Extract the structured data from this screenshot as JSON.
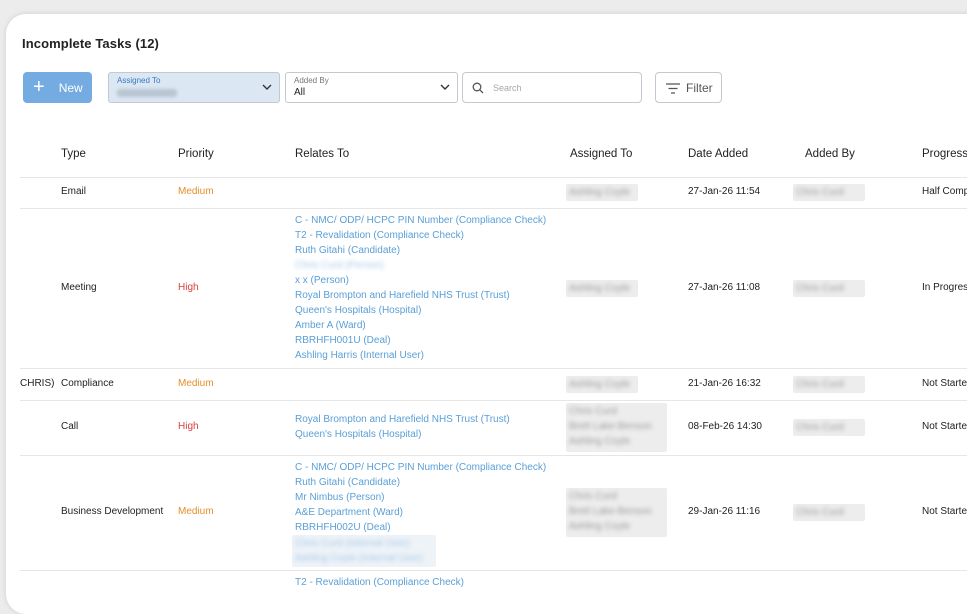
{
  "page": {
    "title": "Incomplete Tasks (12)"
  },
  "toolbar": {
    "new_label": "New",
    "assigned_to": {
      "label": "Assigned To",
      "value": "Ashling Coyle"
    },
    "added_by": {
      "label": "Added By",
      "value": "All"
    },
    "search_placeholder": "Search",
    "filter_label": "Filter"
  },
  "table": {
    "headers": [
      "Type",
      "Priority",
      "Relates To",
      "Assigned To",
      "Date Added",
      "Added By",
      "Progress"
    ],
    "rows": [
      {
        "type": "Email",
        "priority": "Medium",
        "relates_to": [],
        "assigned_to": [
          "Ashling Coyle"
        ],
        "date_added": "27-Jan-26 11:54",
        "added_by": "Chris Curd",
        "progress": "Half Comp"
      },
      {
        "type": "Meeting",
        "priority": "High",
        "relates_to": [
          "C - NMC/ ODP/ HCPC PIN Number (Compliance Check)",
          "T2 - Revalidation (Compliance Check)",
          "Ruth Gitahi (Candidate)",
          "Chris Curd (Person)",
          "x x (Person)",
          "Royal Brompton and Harefield NHS Trust (Trust)",
          "Queen's Hospitals (Hospital)",
          "Amber A (Ward)",
          "RBRHFH001U (Deal)",
          "Ashling Harris (Internal User)"
        ],
        "assigned_to": [
          "Ashling Coyle"
        ],
        "date_added": "27-Jan-26 11:08",
        "added_by": "Chris Curd",
        "progress": "In Progres"
      },
      {
        "type": "Compliance",
        "priority": "Medium",
        "row_prefix": "CHRIS)",
        "relates_to": [],
        "assigned_to": [
          "Ashling Coyle"
        ],
        "date_added": "21-Jan-26 16:32",
        "added_by": "Chris Curd",
        "progress": "Not Starte"
      },
      {
        "type": "Call",
        "priority": "High",
        "relates_to": [
          "Royal Brompton and Harefield NHS Trust (Trust)",
          "Queen's Hospitals (Hospital)"
        ],
        "assigned_to": [
          "Chris Curd",
          "Brett Lake-Benson",
          "Ashling Coyle"
        ],
        "date_added": "08-Feb-26 14:30",
        "added_by": "Chris Curd",
        "progress": "Not Starte"
      },
      {
        "type": "Business Development",
        "priority": "Medium",
        "relates_to": [
          "C - NMC/ ODP/ HCPC PIN Number (Compliance Check)",
          "Ruth Gitahi (Candidate)",
          "Mr Nimbus (Person)",
          "A&E Department (Ward)",
          "RBRHFH002U (Deal)",
          "Chris Curd (Internal User)",
          "Ashling Coyle (Internal User)"
        ],
        "assigned_to": [
          "Chris Curd",
          "Brett Lake-Benson",
          "Ashling Coyle"
        ],
        "date_added": "29-Jan-26 11:16",
        "added_by": "Chris Curd",
        "progress": "Not Starte"
      },
      {
        "relates_to": [
          "T2 - Revalidation (Compliance Check)"
        ]
      }
    ]
  },
  "colors": {
    "accent": "#74ace1",
    "medium": "#e58e2b",
    "high": "#d9413f",
    "link": "#5a9fd6"
  }
}
